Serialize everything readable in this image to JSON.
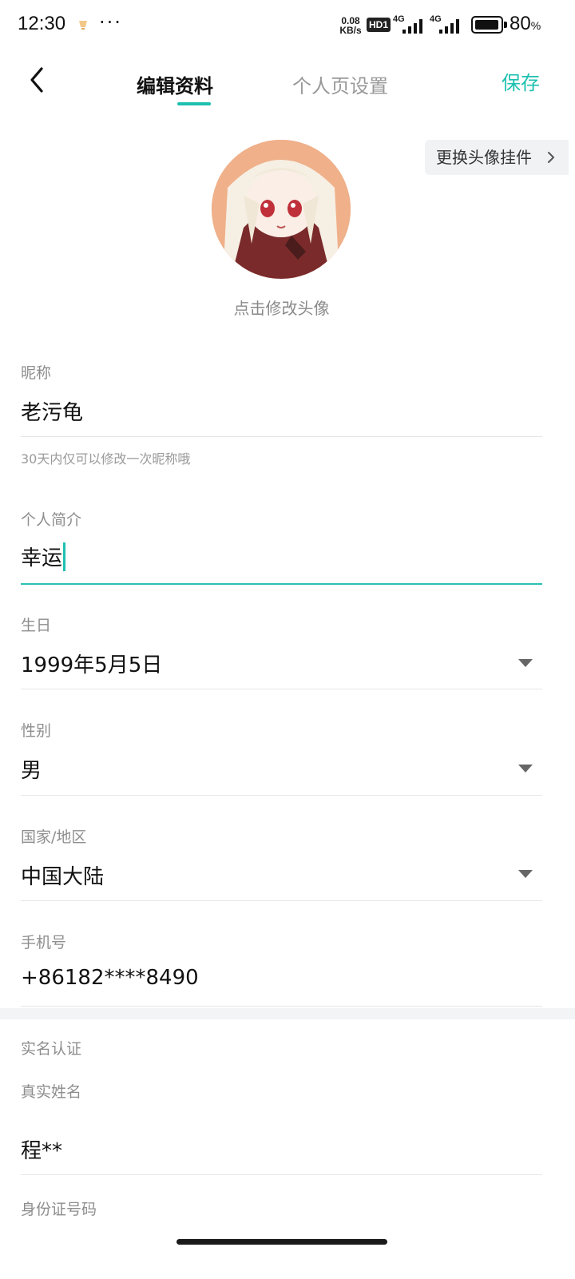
{
  "status_bar": {
    "time": "12:30",
    "dots": "···",
    "speed_value": "0.08",
    "speed_unit": "KB/s",
    "hd": "HD1",
    "net1": "4G",
    "net2": "4G",
    "battery": "80",
    "battery_unit": "%"
  },
  "header": {
    "tabs": [
      {
        "label": "编辑资料",
        "active": true
      },
      {
        "label": "个人页设置",
        "active": false
      }
    ],
    "save_label": "保存",
    "accent_color": "#1ec0b0"
  },
  "avatar": {
    "hint": "点击修改头像",
    "pendant_label": "更换头像挂件"
  },
  "fields": {
    "nickname": {
      "label": "昵称",
      "value": "老污龟",
      "hint": "30天内仅可以修改一次昵称哦"
    },
    "bio": {
      "label": "个人简介",
      "value": "幸运"
    },
    "birthday": {
      "label": "生日",
      "value": "1999年5月5日"
    },
    "gender": {
      "label": "性别",
      "value": "男"
    },
    "region": {
      "label": "国家/地区",
      "value": "中国大陆"
    },
    "phone": {
      "label": "手机号",
      "value": "+86182****8490"
    }
  },
  "verification": {
    "section_label": "实名认证",
    "real_name_label": "真实姓名",
    "real_name_value": "程**",
    "id_label": "身份证号码"
  }
}
